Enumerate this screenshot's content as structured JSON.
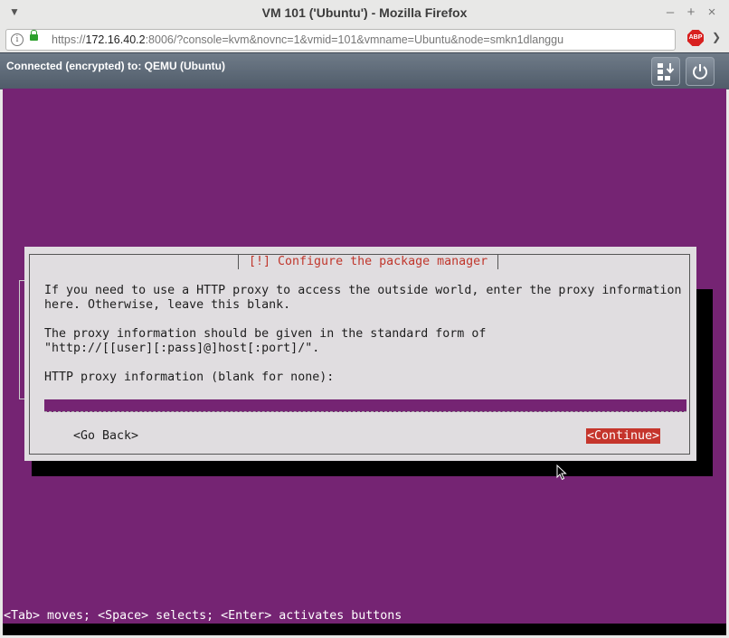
{
  "window": {
    "title": "VM 101 ('Ubuntu') - Mozilla Firefox"
  },
  "browser": {
    "url_prefix": "https://",
    "url_host": "172.16.40.2",
    "url_rest": ":8006/?console=kvm&novnc=1&vmid=101&vmname=Ubuntu&node=smkn1dlanggu",
    "abp_label": "ABP"
  },
  "vnc": {
    "status": "Connected (encrypted) to: QEMU (Ubuntu)"
  },
  "dialog": {
    "title": "[!] Configure the package manager",
    "line1": "If you need to use a HTTP proxy to access the outside world, enter the proxy information",
    "line2": "here. Otherwise, leave this blank.",
    "line3": "The proxy information should be given in the standard form of",
    "line4": "\"http://[[user][:pass]@]host[:port]/\".",
    "field_label": "HTTP proxy information (blank for none):",
    "field_value": "",
    "back_button": "<Go Back>",
    "continue_button": "<Continue>"
  },
  "footer": "<Tab> moves; <Space> selects; <Enter> activates buttons",
  "colors": {
    "console_bg": "#752473",
    "dialog_bg": "#e0dde0",
    "title_red": "#c0362c",
    "button_selected": "#c5352c"
  }
}
